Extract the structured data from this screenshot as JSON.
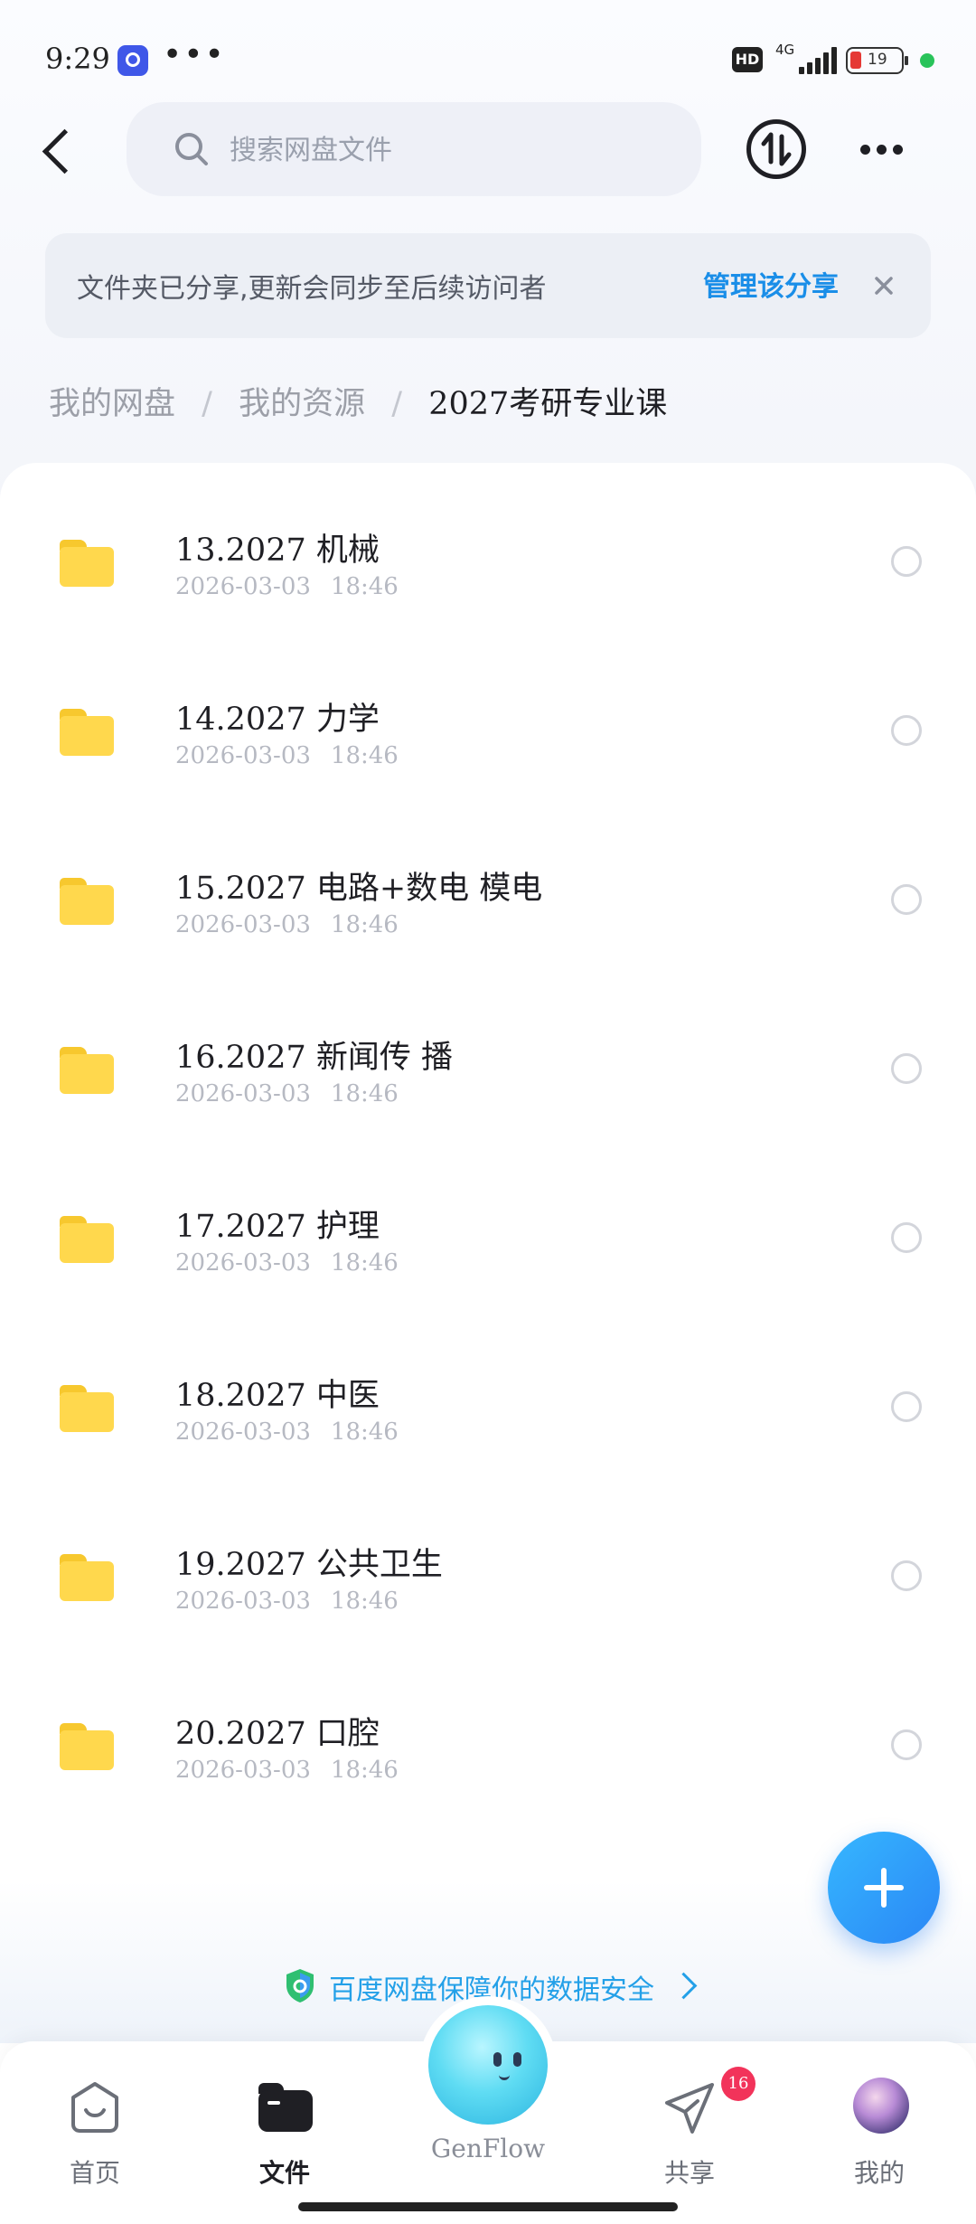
{
  "status_bar": {
    "time": "9:29",
    "more": "•••",
    "hd": "HD",
    "network": "4G",
    "battery": "19"
  },
  "header": {
    "search_placeholder": "搜索网盘文件"
  },
  "share_banner": {
    "text": "文件夹已分享,更新会同步至后续访问者",
    "link": "管理该分享"
  },
  "breadcrumb": {
    "items": [
      "我的网盘",
      "我的资源",
      "2027考研专业课"
    ],
    "separator": "/"
  },
  "files": [
    {
      "name": "13.2027 机械",
      "date": "2026-03-03",
      "time": "18:46"
    },
    {
      "name": "14.2027 力学",
      "date": "2026-03-03",
      "time": "18:46"
    },
    {
      "name": "15.2027 电路+数电 模电",
      "date": "2026-03-03",
      "time": "18:46"
    },
    {
      "name": "16.2027 新闻传 播",
      "date": "2026-03-03",
      "time": "18:46"
    },
    {
      "name": "17.2027 护理",
      "date": "2026-03-03",
      "time": "18:46"
    },
    {
      "name": "18.2027 中医",
      "date": "2026-03-03",
      "time": "18:46"
    },
    {
      "name": "19.2027 公共卫生",
      "date": "2026-03-03",
      "time": "18:46"
    },
    {
      "name": "20.2027 口腔",
      "date": "2026-03-03",
      "time": "18:46"
    }
  ],
  "security_notice": "百度网盘保障你的数据安全",
  "bottom_nav": {
    "home": "首页",
    "files": "文件",
    "genflow": "GenFlow",
    "share": "共享",
    "share_badge": "16",
    "me": "我的"
  },
  "colors": {
    "accent": "#1a8ee8",
    "folder": "#ffd84d",
    "fab": "#2a86f5",
    "badge": "#f2335a"
  },
  "icons": [
    "back-arrow-icon",
    "search-icon",
    "transfer-icon",
    "more-icon",
    "close-icon",
    "folder-icon",
    "plus-icon",
    "shield-icon",
    "home-icon",
    "files-icon",
    "share-icon"
  ]
}
